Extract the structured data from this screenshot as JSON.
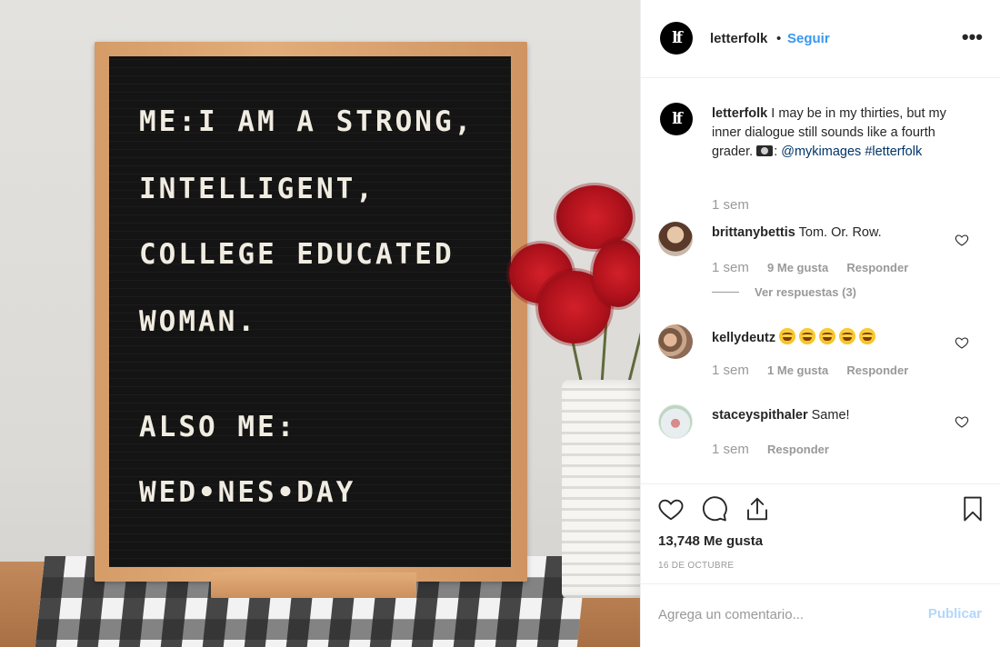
{
  "photo": {
    "board_lines": [
      "ME:I AM A STRONG,",
      "INTELLIGENT,",
      "COLLEGE EDUCATED",
      "WOMAN.",
      "ALSO ME:",
      "WED•NES•DAY"
    ]
  },
  "header": {
    "avatar_icon": "letterfolk-logo-icon",
    "logo_text": "lf",
    "username": "letterfolk",
    "separator": "•",
    "follow_label": "Seguir",
    "more_icon": "more-options-icon",
    "more_symbol": "•••"
  },
  "caption": {
    "username": "letterfolk",
    "text": "I may be in my thirties, but my inner dialogue still sounds like a fourth grader.",
    "camera_icon": "camera-icon",
    "credit_prefix": ":",
    "mention": "@mykimages",
    "hashtag": "#letterfolk",
    "time": "1 sem"
  },
  "comments": [
    {
      "username": "brittanybettis",
      "text": "Tom. Or. Row.",
      "time": "1 sem",
      "likes": "9 Me gusta",
      "reply_label": "Responder",
      "view_replies": "Ver respuestas (3)"
    },
    {
      "username": "kellydeutz",
      "text": "",
      "emoji_icons": [
        "joy-emoji-icon",
        "joy-emoji-icon",
        "joy-emoji-icon",
        "joy-emoji-icon",
        "joy-emoji-icon"
      ],
      "time": "1 sem",
      "likes": "1 Me gusta",
      "reply_label": "Responder"
    },
    {
      "username": "staceyspithaler",
      "text": "Same!",
      "time": "1 sem",
      "reply_label": "Responder"
    }
  ],
  "actions": {
    "icons": [
      "heart-icon",
      "comment-icon",
      "share-icon",
      "bookmark-icon"
    ],
    "likes_count": "13,748 Me gusta",
    "date": "16 DE OCTUBRE"
  },
  "comment_box": {
    "placeholder": "Agrega un comentario...",
    "publish_label": "Publicar"
  },
  "colors": {
    "link_blue": "#3897f0",
    "publish_disabled": "#b3d7fb",
    "muted_text": "#999999",
    "text": "#262626"
  }
}
